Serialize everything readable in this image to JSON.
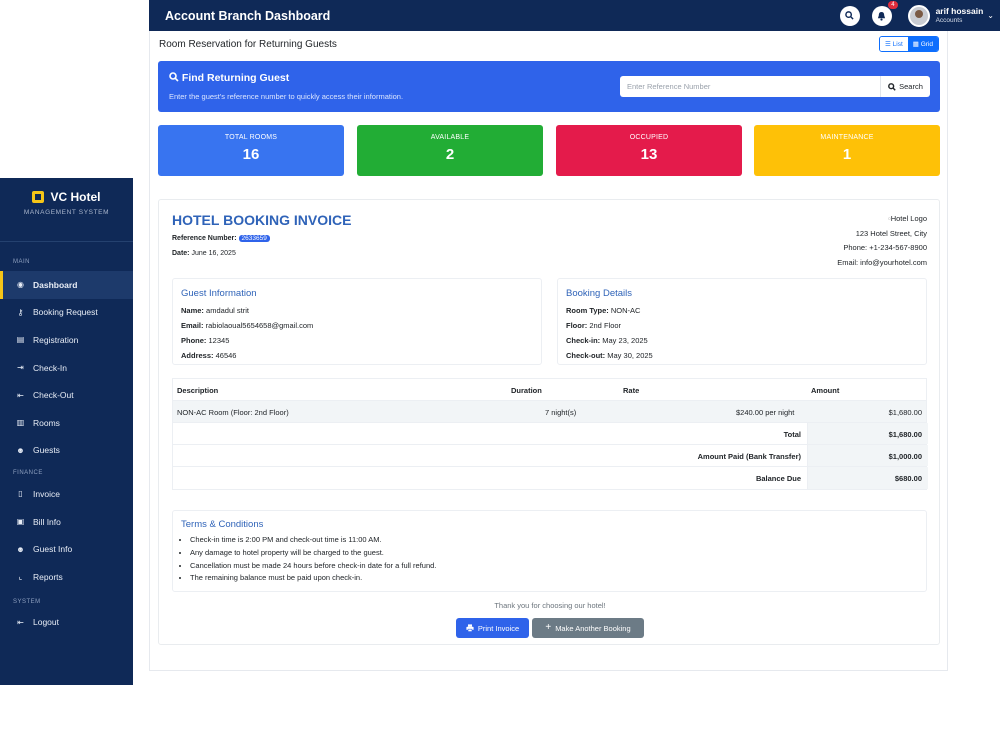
{
  "topbar": {
    "title": "Account Branch Dashboard",
    "notif_count": "4",
    "user_name": "arif hossain",
    "user_role": "Accounts"
  },
  "sidebar": {
    "brand": "VC Hotel",
    "brand_sub": "MANAGEMENT SYSTEM",
    "sections": {
      "main": "MAIN",
      "finance": "FINANCE",
      "system": "SYSTEM"
    },
    "items": [
      {
        "label": "Dashboard",
        "icon": "gauge-icon",
        "glyph": "◉"
      },
      {
        "label": "Booking Request",
        "icon": "key-icon",
        "glyph": "⚷"
      },
      {
        "label": "Registration",
        "icon": "id-card-icon",
        "glyph": "▤"
      },
      {
        "label": "Check-In",
        "icon": "sign-in-icon",
        "glyph": "⇥"
      },
      {
        "label": "Check-Out",
        "icon": "sign-out-icon",
        "glyph": "⇤"
      },
      {
        "label": "Rooms",
        "icon": "door-icon",
        "glyph": "▥"
      },
      {
        "label": "Guests",
        "icon": "users-icon",
        "glyph": "☻"
      },
      {
        "label": "Invoice",
        "icon": "file-icon",
        "glyph": "▯"
      },
      {
        "label": "Bill Info",
        "icon": "money-icon",
        "glyph": "▣"
      },
      {
        "label": "Guest Info",
        "icon": "users-icon",
        "glyph": "☻"
      },
      {
        "label": "Reports",
        "icon": "chart-icon",
        "glyph": "⌞"
      },
      {
        "label": "Logout",
        "icon": "sign-out-icon",
        "glyph": "⇤"
      }
    ]
  },
  "page": {
    "title": "Room Reservation for Returning Guests",
    "view_list": "List",
    "view_grid": "Grid"
  },
  "find": {
    "title": "Find Returning Guest",
    "desc": "Enter the guest's reference number to quickly access their information.",
    "placeholder": "Enter Reference Number",
    "button": "Search"
  },
  "stats": [
    {
      "label": "TOTAL ROOMS",
      "value": "16",
      "color": "#3874f0"
    },
    {
      "label": "AVAILABLE",
      "value": "2",
      "color": "#22ad35"
    },
    {
      "label": "OCCUPIED",
      "value": "13",
      "color": "#e41b4b"
    },
    {
      "label": "MAINTENANCE",
      "value": "1",
      "color": "#fec107"
    }
  ],
  "invoice": {
    "title": "HOTEL BOOKING INVOICE",
    "ref_label": "Reference Number:",
    "ref_value": "2633659",
    "date_label": "Date:",
    "date_value": "June 16, 2025",
    "hotel_logo_alt": "Hotel Logo",
    "hotel_address": "123 Hotel Street, City",
    "hotel_phone": "Phone: +1-234-567-8900",
    "hotel_email": "Email: info@yourhotel.com",
    "guest": {
      "title": "Guest Information",
      "name_label": "Name:",
      "name": "amdadul strit",
      "email_label": "Email:",
      "email": "rabiolaoual5654658@gmail.com",
      "phone_label": "Phone:",
      "phone": "12345",
      "address_label": "Address:",
      "address": "46546"
    },
    "booking": {
      "title": "Booking Details",
      "room_type_label": "Room Type:",
      "room_type": "NON-AC",
      "floor_label": "Floor:",
      "floor": "2nd Floor",
      "checkin_label": "Check-in:",
      "checkin": "May 23, 2025",
      "checkout_label": "Check-out:",
      "checkout": "May 30, 2025"
    },
    "table": {
      "headers": {
        "description": "Description",
        "duration": "Duration",
        "rate": "Rate",
        "amount": "Amount"
      },
      "item": {
        "description": "NON-AC Room (Floor: 2nd Floor)",
        "duration": "7 night(s)",
        "rate": "$240.00 per night",
        "amount": "$1,680.00"
      },
      "total_label": "Total",
      "total": "$1,680.00",
      "paid_label": "Amount Paid (Bank Transfer)",
      "paid": "$1,000.00",
      "balance_label": "Balance Due",
      "balance": "$680.00"
    },
    "terms": {
      "title": "Terms & Conditions",
      "items": [
        "Check-in time is 2:00 PM and check-out time is 11:00 AM.",
        "Any damage to hotel property will be charged to the guest.",
        "Cancellation must be made 24 hours before check-in date for a full refund.",
        "The remaining balance must be paid upon check-in."
      ]
    },
    "thanks": "Thank you for choosing our hotel!",
    "print_button": "Print Invoice",
    "another_button": "Make Another Booking"
  }
}
